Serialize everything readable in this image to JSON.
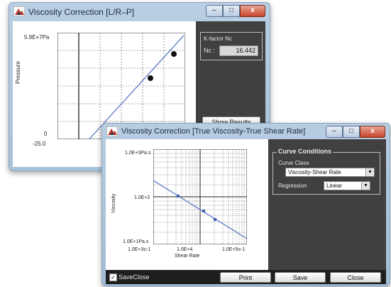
{
  "back_window": {
    "title": "Viscosity Correction [L/R–P]",
    "y_top_label": "5.9E+7Pa",
    "y_axis_label": "Pressure",
    "y_zero_label": "0",
    "x_left_label": "-25.0",
    "kfactor_label": "K-factor Nc",
    "nc_label": "Nc :",
    "nc_value": "16.442",
    "show_results_label": "Show Results",
    "controls": {
      "minimize": "–",
      "maximize": "□",
      "close": "x"
    },
    "icon": "app-logo-icon"
  },
  "front_window": {
    "title": "Viscosity Correction [True Viscosity-True Shear Rate]",
    "y_top_label": "1.0E+3Pa.s",
    "y_mid_label": "1.0E+2",
    "y_bottom_label": "1.0E+1Pa.s",
    "y_axis_label": "Viscosity",
    "x_left_label": "1.0E+3s-1",
    "x_mid_label": "1.0E+4",
    "x_right_label": "1.0E+5s-1",
    "x_axis_label": "Shear Rate",
    "curve_conditions_label": "Curve Conditions",
    "curve_class_label": "Curve Class",
    "curve_class_value": "Viscosity-Shear Rate",
    "regression_label": "Regression",
    "regression_value": "Linear",
    "saveclose_label": "SaveClose",
    "saveclose_checked": true,
    "print_label": "Print",
    "save_label": "Save",
    "close_label": "Close",
    "controls": {
      "minimize": "–",
      "maximize": "□",
      "close": "x"
    },
    "icon": "app-logo-icon"
  },
  "colors": {
    "accent_line": "#5b78c8",
    "panel_dark": "#404040",
    "point": "#111111"
  }
}
